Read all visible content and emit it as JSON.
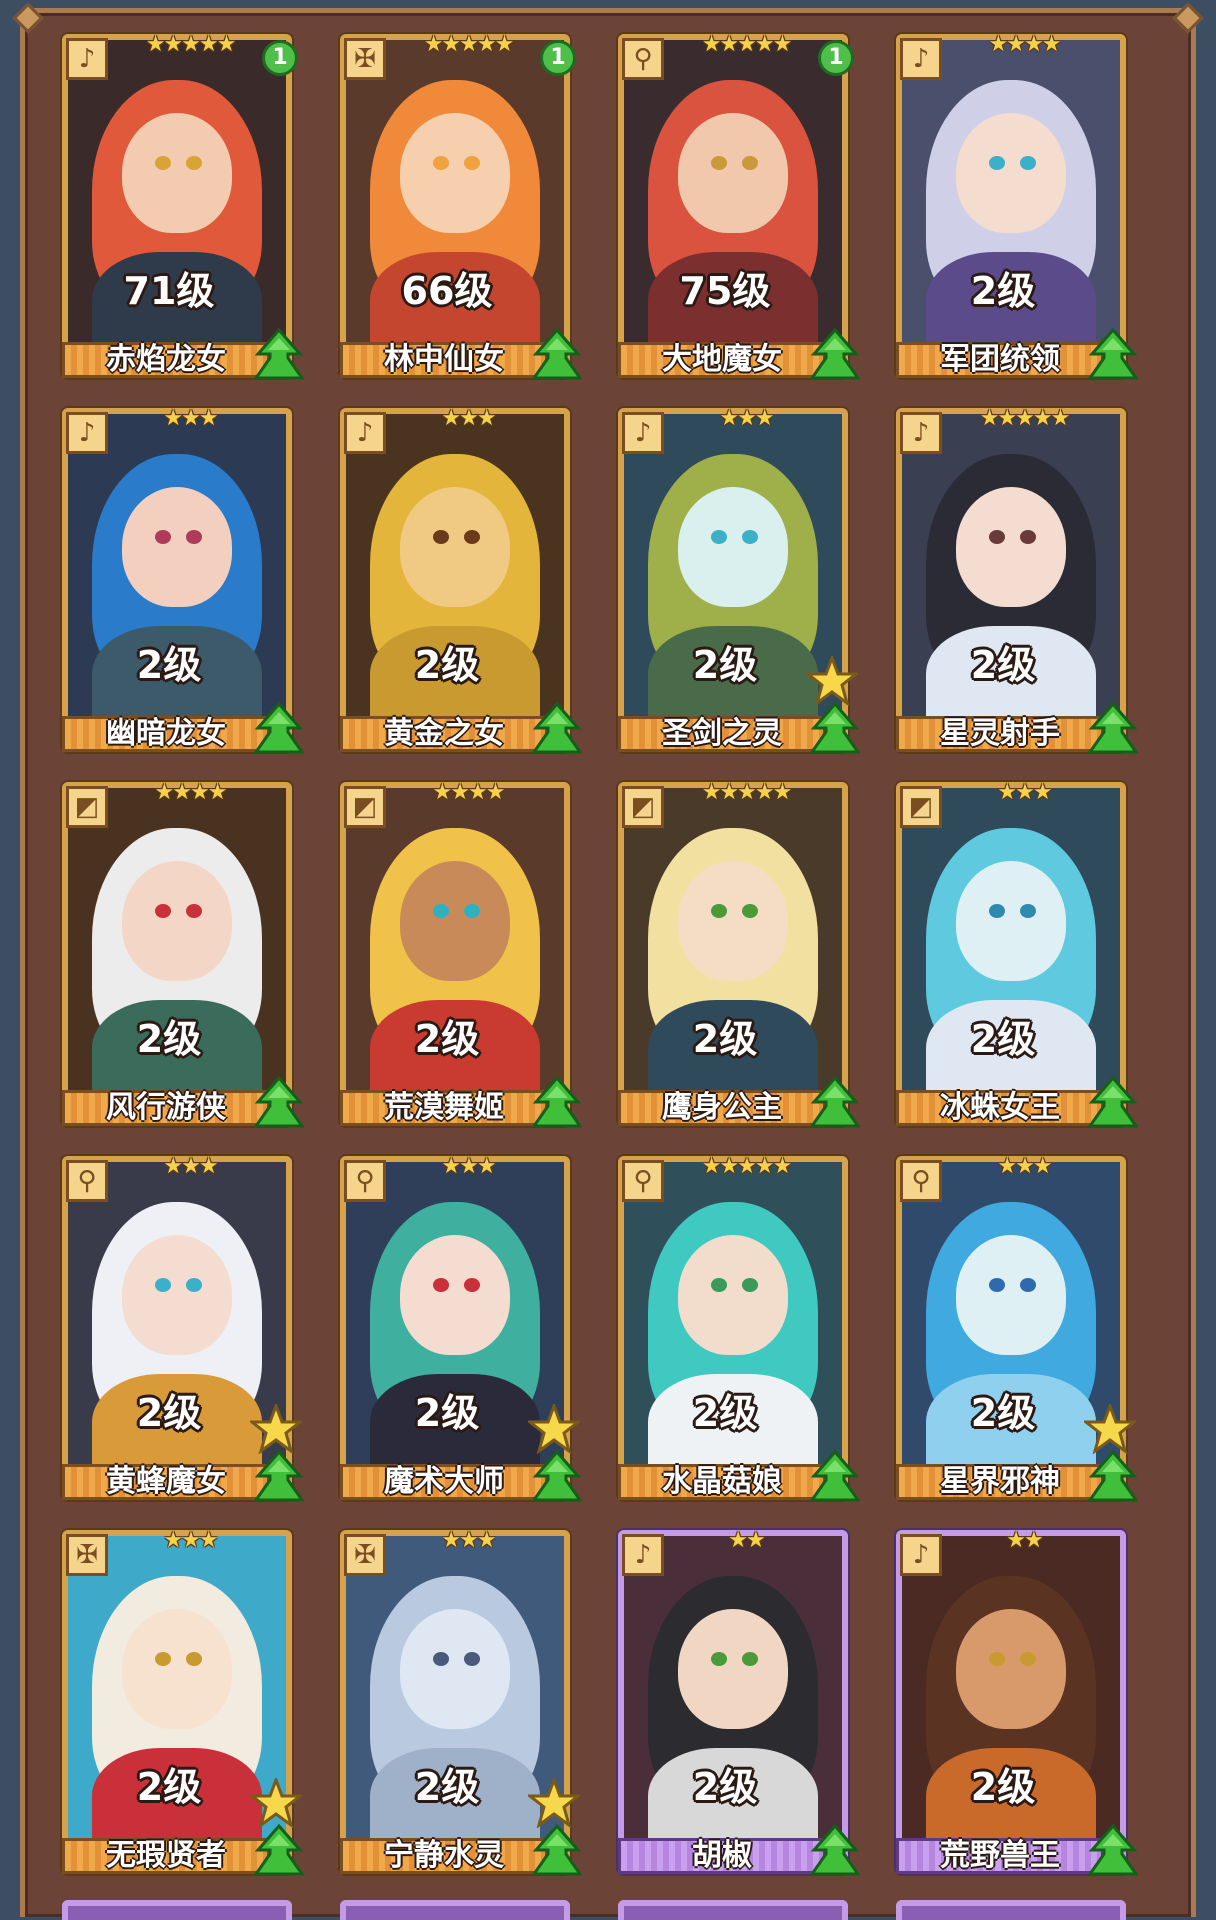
{
  "cards": [
    {
      "name": "赤焰龙女",
      "level": "71级",
      "stars": 5,
      "badge": "1",
      "role_icon": "flute-icon",
      "frame": "gold",
      "star_mark": false,
      "art": {
        "bg": "#3b2a2a",
        "hair": "#e0593a",
        "skin": "#f2cbb0",
        "outfit": "#2f3b4a",
        "eye": "#d9a436"
      }
    },
    {
      "name": "林中仙女",
      "level": "66级",
      "stars": 5,
      "badge": "1",
      "role_icon": "shield-icon",
      "frame": "gold",
      "star_mark": false,
      "art": {
        "bg": "#5a3a2a",
        "hair": "#f08a3a",
        "skin": "#f5cfae",
        "outfit": "#c4462f",
        "eye": "#f0a140"
      }
    },
    {
      "name": "大地魔女",
      "level": "75级",
      "stars": 5,
      "badge": "1",
      "role_icon": "staff-icon",
      "frame": "gold",
      "star_mark": false,
      "art": {
        "bg": "#3a2b2f",
        "hair": "#d9533f",
        "skin": "#f2c8ac",
        "outfit": "#7b2f2f",
        "eye": "#c99a3a"
      }
    },
    {
      "name": "军团统领",
      "level": "2级",
      "stars": 4,
      "badge": "",
      "role_icon": "flute-icon",
      "frame": "gold",
      "star_mark": false,
      "art": {
        "bg": "#4a4f6b",
        "hair": "#cfcfe8",
        "skin": "#f4dccf",
        "outfit": "#5b4b8a",
        "eye": "#3bb0c9"
      }
    },
    {
      "name": "幽暗龙女",
      "level": "2级",
      "stars": 3,
      "badge": "",
      "role_icon": "flute-icon",
      "frame": "gold",
      "star_mark": false,
      "art": {
        "bg": "#2d3a54",
        "hair": "#2a7bc9",
        "skin": "#f2cfbf",
        "outfit": "#3d5a6b",
        "eye": "#b03a5a"
      }
    },
    {
      "name": "黄金之女",
      "level": "2级",
      "stars": 3,
      "badge": "",
      "role_icon": "flute-icon",
      "frame": "gold",
      "star_mark": false,
      "art": {
        "bg": "#4a3420",
        "hair": "#e3b53a",
        "skin": "#f0c983",
        "outfit": "#c99a2f",
        "eye": "#6b3a1a"
      }
    },
    {
      "name": "圣剑之灵",
      "level": "2级",
      "stars": 3,
      "badge": "",
      "role_icon": "flute-icon",
      "frame": "gold",
      "star_mark": true,
      "art": {
        "bg": "#2f4a5a",
        "hair": "#9fb04a",
        "skin": "#d9f0ef",
        "outfit": "#4a6b4a",
        "eye": "#3bb0c9"
      }
    },
    {
      "name": "星灵射手",
      "level": "2级",
      "stars": 5,
      "badge": "",
      "role_icon": "flute-icon",
      "frame": "gold",
      "star_mark": false,
      "art": {
        "bg": "#3b3f52",
        "hair": "#2b2b36",
        "skin": "#f5dcd0",
        "outfit": "#dfe8f2",
        "eye": "#6b3a3a"
      }
    },
    {
      "name": "风行游侠",
      "level": "2级",
      "stars": 4,
      "badge": "",
      "role_icon": "bow-icon",
      "frame": "gold",
      "star_mark": false,
      "art": {
        "bg": "#4a3220",
        "hair": "#ececec",
        "skin": "#f4d6c6",
        "outfit": "#3b6b5a",
        "eye": "#c9303a"
      }
    },
    {
      "name": "荒漠舞姬",
      "level": "2级",
      "stars": 4,
      "badge": "",
      "role_icon": "bow-icon",
      "frame": "gold",
      "star_mark": false,
      "art": {
        "bg": "#5a3a2a",
        "hair": "#f0c24a",
        "skin": "#c98a5a",
        "outfit": "#c93a30",
        "eye": "#2fb0c0"
      }
    },
    {
      "name": "鹰身公主",
      "level": "2级",
      "stars": 5,
      "badge": "",
      "role_icon": "bow-icon",
      "frame": "gold",
      "star_mark": false,
      "art": {
        "bg": "#4a3a2a",
        "hair": "#f2e0a0",
        "skin": "#f5dcc4",
        "outfit": "#2f4a5a",
        "eye": "#4a9a3a"
      }
    },
    {
      "name": "冰蛛女王",
      "level": "2级",
      "stars": 3,
      "badge": "",
      "role_icon": "bow-icon",
      "frame": "gold",
      "star_mark": false,
      "art": {
        "bg": "#2f4a5a",
        "hair": "#5fc9e0",
        "skin": "#dff0f5",
        "outfit": "#dfe8f2",
        "eye": "#2f8ab0"
      }
    },
    {
      "name": "黄蜂魔女",
      "level": "2级",
      "stars": 3,
      "badge": "",
      "role_icon": "staff-icon",
      "frame": "gold",
      "star_mark": true,
      "art": {
        "bg": "#3a3b4a",
        "hair": "#eef0f5",
        "skin": "#f5dcd0",
        "outfit": "#d99a3a",
        "eye": "#3bb0c9"
      }
    },
    {
      "name": "魔术大师",
      "level": "2级",
      "stars": 3,
      "badge": "",
      "role_icon": "staff-icon",
      "frame": "gold",
      "star_mark": true,
      "art": {
        "bg": "#2f3f5a",
        "hair": "#3fb0a0",
        "skin": "#f5dcd0",
        "outfit": "#2a2a3a",
        "eye": "#c9303a"
      }
    },
    {
      "name": "水晶菇娘",
      "level": "2级",
      "stars": 5,
      "badge": "",
      "role_icon": "staff-icon",
      "frame": "gold",
      "star_mark": false,
      "art": {
        "bg": "#2f4f5a",
        "hair": "#3fc9c0",
        "skin": "#f2dccb",
        "outfit": "#eef2f5",
        "eye": "#3a9a5a"
      }
    },
    {
      "name": "星界邪神",
      "level": "2级",
      "stars": 3,
      "badge": "",
      "role_icon": "staff-icon",
      "frame": "gold",
      "star_mark": true,
      "art": {
        "bg": "#2f4a6b",
        "hair": "#3fa9e0",
        "skin": "#dff0f5",
        "outfit": "#8fd0ef",
        "eye": "#2f6ab0"
      }
    },
    {
      "name": "无瑕贤者",
      "level": "2级",
      "stars": 3,
      "badge": "",
      "role_icon": "shield-icon",
      "frame": "gold",
      "star_mark": true,
      "art": {
        "bg": "#3fa9c9",
        "hair": "#f2ebe0",
        "skin": "#f7e2cf",
        "outfit": "#c9303a",
        "eye": "#c99a2f"
      }
    },
    {
      "name": "宁静水灵",
      "level": "2级",
      "stars": 3,
      "badge": "",
      "role_icon": "shield-icon",
      "frame": "gold",
      "star_mark": true,
      "art": {
        "bg": "#3f5a7a",
        "hair": "#b8c9e0",
        "skin": "#dfe8f2",
        "outfit": "#9fb0c9",
        "eye": "#4a5a7a"
      }
    },
    {
      "name": "胡椒",
      "level": "2级",
      "stars": 2,
      "badge": "",
      "role_icon": "flute-icon",
      "frame": "purple",
      "star_mark": false,
      "art": {
        "bg": "#4a2f3a",
        "hair": "#2b2b30",
        "skin": "#f2d6c4",
        "outfit": "#d8d8d8",
        "eye": "#4a9a3a"
      }
    },
    {
      "name": "荒野兽王",
      "level": "2级",
      "stars": 2,
      "badge": "",
      "role_icon": "flute-icon",
      "frame": "purple",
      "star_mark": false,
      "art": {
        "bg": "#4a2a22",
        "hair": "#5a3322",
        "skin": "#d99a6b",
        "outfit": "#c96a2a",
        "eye": "#c99a2f"
      }
    }
  ],
  "next_row_frames": [
    "purple",
    "purple",
    "purple",
    "purple"
  ]
}
